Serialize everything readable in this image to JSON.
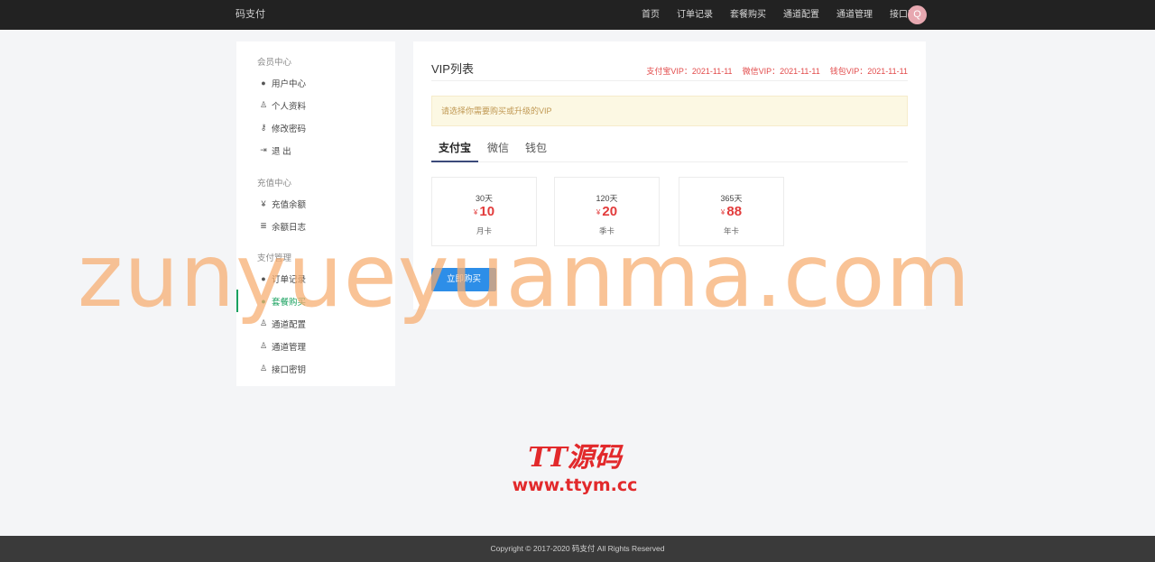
{
  "brand": "码支付",
  "nav": {
    "items": [
      "首页",
      "订单记录",
      "套餐购买",
      "通道配置",
      "通道管理",
      "接口密钥"
    ],
    "avatar_letter": "Q"
  },
  "sidebar": {
    "groups": [
      {
        "title": "会员中心",
        "items": [
          {
            "label": "用户中心",
            "icon": "user-circle-icon"
          },
          {
            "label": "个人资料",
            "icon": "user-icon"
          },
          {
            "label": "修改密码",
            "icon": "key-icon"
          },
          {
            "label": "退 出",
            "icon": "logout-icon"
          }
        ]
      },
      {
        "title": "充值中心",
        "items": [
          {
            "label": "充值余额",
            "icon": "yen-icon"
          },
          {
            "label": "余额日志",
            "icon": "list-icon"
          }
        ]
      },
      {
        "title": "支付管理",
        "items": [
          {
            "label": "订单记录",
            "icon": "user-circle-icon"
          },
          {
            "label": "套餐购买",
            "icon": "user-circle-icon",
            "active": true
          },
          {
            "label": "通道配置",
            "icon": "user-icon"
          },
          {
            "label": "通道管理",
            "icon": "user-icon"
          },
          {
            "label": "接口密钥",
            "icon": "user-icon"
          }
        ]
      }
    ]
  },
  "main": {
    "title": "VIP列表",
    "vip_status": [
      "支付宝VIP：2021-11-11",
      "微信VIP：2021-11-11",
      "钱包VIP：2021-11-11"
    ],
    "alert": "请选择你需要购买或升级的VIP",
    "tabs": [
      "支付宝",
      "微信",
      "钱包"
    ],
    "active_tab": 0,
    "plans": [
      {
        "days": "30天",
        "currency": "¥",
        "price": "10",
        "name": "月卡"
      },
      {
        "days": "120天",
        "currency": "¥",
        "price": "20",
        "name": "季卡"
      },
      {
        "days": "365天",
        "currency": "¥",
        "price": "88",
        "name": "年卡"
      }
    ],
    "buy_button": "立即购买"
  },
  "watermark": "zunyueyuanma.com",
  "logo": {
    "line1": "TT源码",
    "line2": "www.ttym.cc"
  },
  "footer": "Copyright © 2017-2020 码支付 All Rights Reserved",
  "colors": {
    "topbar": "#222222",
    "accent_active": "#19a15f",
    "price": "#e23b3b",
    "button": "#2d8ee8",
    "alert_bg": "#fcf8e3",
    "footer": "#3a3a3a"
  }
}
